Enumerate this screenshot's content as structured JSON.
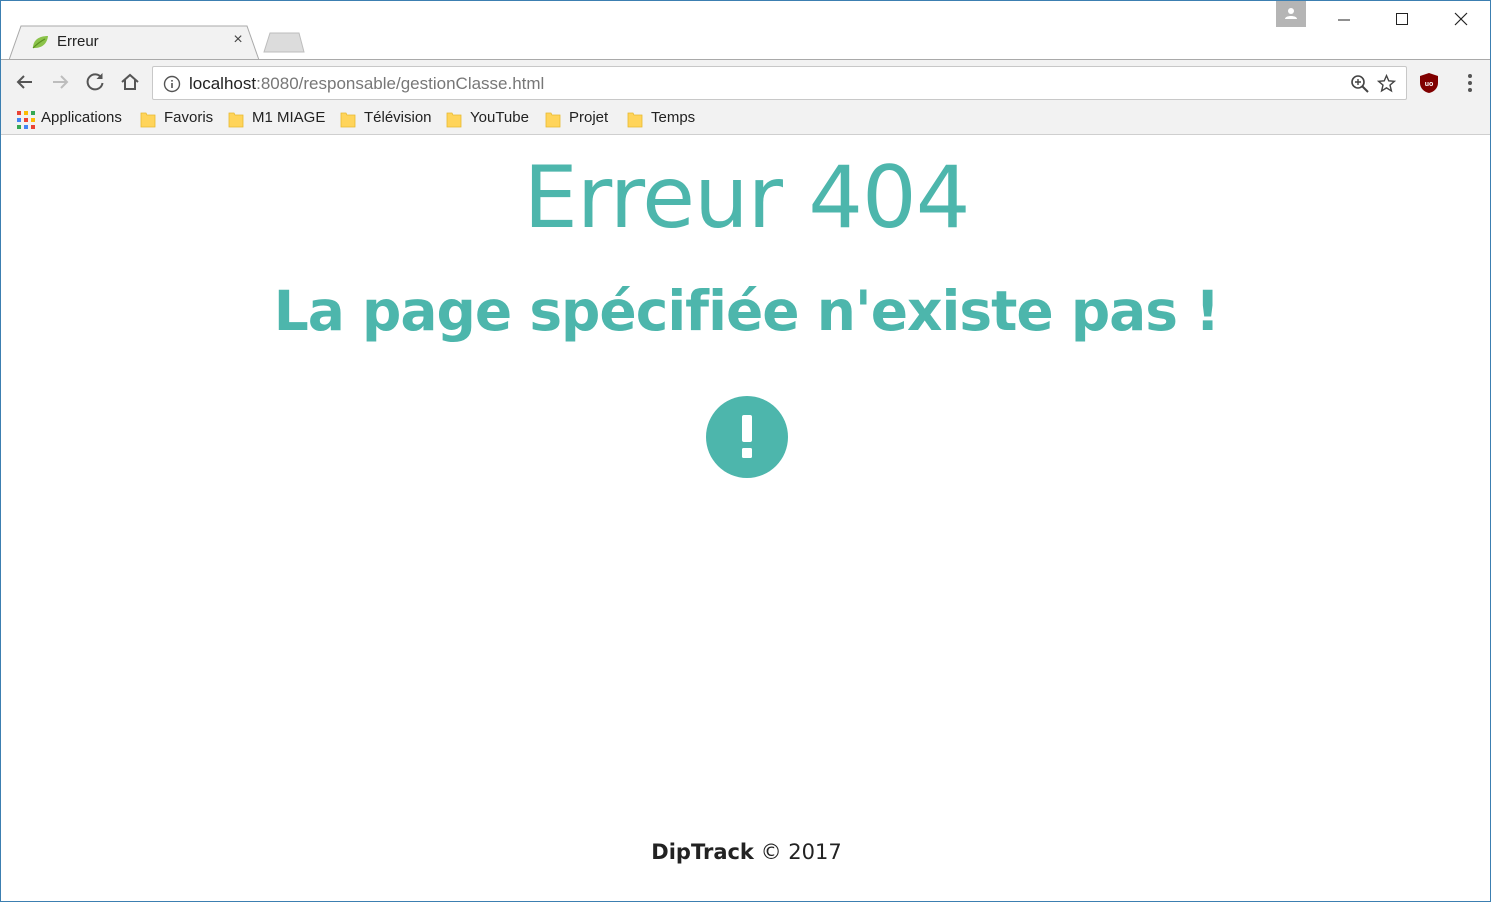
{
  "tab": {
    "title": "Erreur",
    "close": "×"
  },
  "toolbar": {
    "url_host": "localhost",
    "url_path": ":8080/responsable/gestionClasse.html"
  },
  "bookmarks": [
    {
      "label": "Applications"
    },
    {
      "label": "Favoris"
    },
    {
      "label": "M1 MIAGE"
    },
    {
      "label": "Télévision"
    },
    {
      "label": "YouTube"
    },
    {
      "label": "Projet"
    },
    {
      "label": "Temps"
    }
  ],
  "page": {
    "title": "Erreur 404",
    "subtitle": "La page spécifiée n'existe pas !",
    "icon": "alert-circle-icon"
  },
  "footer": {
    "brand": "DipTrack",
    "copyright": "© 2017"
  },
  "colors": {
    "accent": "#4db6ac",
    "folder": "#ffd45a"
  }
}
